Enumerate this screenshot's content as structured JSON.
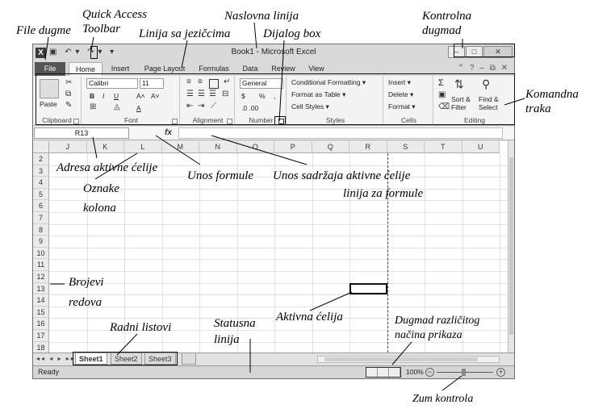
{
  "annotations": {
    "file_button": "File dugme",
    "quick_access_line1": "Quick Access",
    "quick_access_line2": "Toolbar",
    "tabs_line": "Linija sa jezičcima",
    "title_bar": "Naslovna linija",
    "dialog_box": "Dijalog box",
    "control_buttons_line1": "Kontrolna",
    "control_buttons_line2": "dugmad",
    "command_ribbon_line1": "Komandna",
    "command_ribbon_line2": "traka",
    "active_cell_address": "Adresa aktivne ćelije",
    "column_labels_line1": "Oznake",
    "column_labels_line2": "kolona",
    "formula_entry": "Unos formule",
    "active_cell_content_line1": "Unos sadržaja aktivne ćelije",
    "active_cell_content_line2": "linija  za formule",
    "row_numbers_line1": "Brojevi",
    "row_numbers_line2": "redova",
    "active_cell": "Aktivna ćelija",
    "worksheets": "Radni listovi",
    "status_bar_line1": "Statusna",
    "status_bar_line2": "linija",
    "view_buttons_line1": "Dugmad različitog",
    "view_buttons_line2": "načina prikaza",
    "zoom_control": "Zum kontrola"
  },
  "window": {
    "title": "Book1 - Microsoft Excel",
    "app_icon": "X",
    "qat_icons": [
      "save-icon",
      "undo-icon",
      "redo-icon",
      "customize-icon"
    ],
    "qat_glyphs": [
      "▣",
      "↶ ▾",
      "↷ ▾",
      "▾"
    ],
    "controls": [
      "–",
      "□",
      "✕"
    ]
  },
  "tabs": [
    "File",
    "Home",
    "Insert",
    "Page Layout",
    "Formulas",
    "Data",
    "Review",
    "View"
  ],
  "tabs_right_glyphs": "⌃ ? – ⧉ ✕",
  "ribbon": {
    "clipboard": {
      "label": "Clipboard",
      "paste": "Paste"
    },
    "font": {
      "label": "Font",
      "family": "Calibri",
      "size": "11",
      "bold": "B",
      "italic": "I",
      "underline": "U",
      "grow": "A˄",
      "shrink": "A˅",
      "color_a": "A"
    },
    "alignment": {
      "label": "Alignment"
    },
    "number": {
      "label": "Number",
      "format": "General",
      "currency": "$",
      "percent": "%",
      "comma": ",",
      "inc_dec": ".0 .00"
    },
    "styles": {
      "label": "Styles",
      "conditional": "Conditional Formatting",
      "table": "Format as Table",
      "cell_styles": "Cell Styles"
    },
    "cells": {
      "label": "Cells",
      "insert": "Insert",
      "delete": "Delete",
      "format": "Format"
    },
    "editing": {
      "label": "Editing",
      "sigma": "Σ",
      "sort": "Sort &",
      "sort2": "Filter",
      "find": "Find &",
      "find2": "Select"
    }
  },
  "formula_bar": {
    "name_box": "R13",
    "fx": "fx",
    "value": ""
  },
  "columns": [
    "J",
    "K",
    "L",
    "M",
    "N",
    "O",
    "P",
    "Q",
    "R",
    "S",
    "T",
    "U"
  ],
  "rows": [
    "2",
    "3",
    "4",
    "5",
    "6",
    "7",
    "8",
    "9",
    "10",
    "11",
    "12",
    "13",
    "14",
    "15",
    "16",
    "17",
    "18"
  ],
  "sheets": [
    "Sheet1",
    "Sheet2",
    "Sheet3"
  ],
  "sheet_nav": "◂◂ ◂ ▸ ▸▸",
  "status": {
    "ready": "Ready",
    "zoom": "100%",
    "zoom_minus": "−",
    "zoom_plus": "+"
  }
}
